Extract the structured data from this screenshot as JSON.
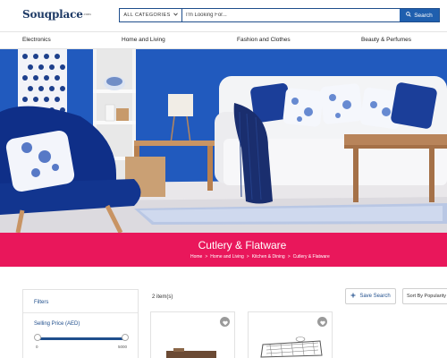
{
  "header": {
    "logo": "Souqplace",
    "logo_suffix": ".com",
    "search": {
      "category": "ALL CATEGORIES",
      "placeholder": "I'm Looking For...",
      "button_label": "Search"
    }
  },
  "nav": {
    "items": [
      {
        "label": "Electronics"
      },
      {
        "label": "Home and Living"
      },
      {
        "label": "Fashion and Clothes"
      },
      {
        "label": "Beauty & Perfumes"
      }
    ]
  },
  "banner": {
    "title": "Cutlery & Flatware",
    "breadcrumbs": [
      "Home",
      "Home and Living",
      "Kitchen & Dining",
      "Cutlery & Flatware"
    ],
    "separator": ">"
  },
  "filters": {
    "title": "Filters",
    "price_label": "Selling Price (AED)",
    "price_min": "0",
    "price_max": "5000"
  },
  "results": {
    "count_text": "2 item(s)",
    "save_search_label": "Save Search",
    "sort_label": "Sort By Popularity"
  },
  "colors": {
    "brand_blue": "#1f4e8c",
    "search_button": "#1f5fae",
    "banner_pink": "#e9175b"
  }
}
